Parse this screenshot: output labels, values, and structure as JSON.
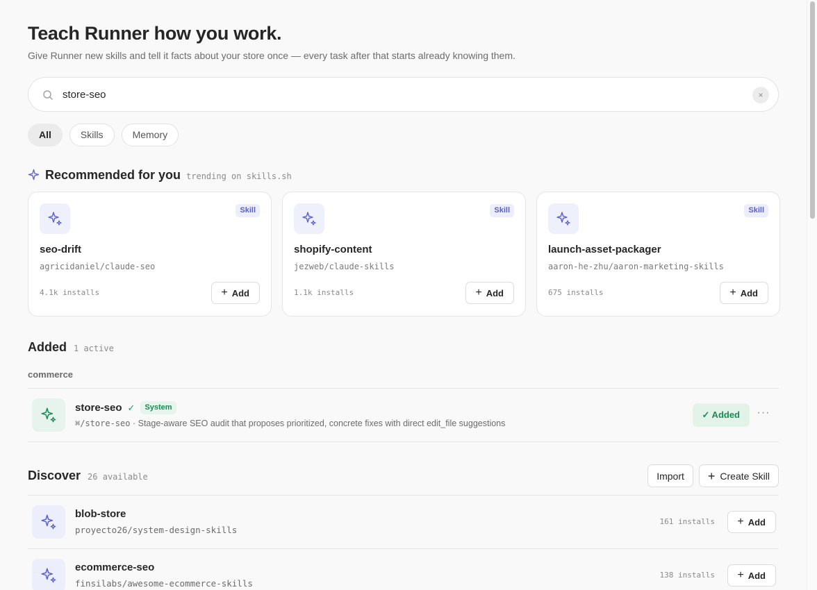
{
  "header": {
    "title": "Teach Runner how you work.",
    "subtitle": "Give Runner new skills and tell it facts about your store once — every task after that starts already knowing them."
  },
  "search": {
    "value": "store-seo",
    "clear_label": "×",
    "icon": "search-icon"
  },
  "filters": [
    "All",
    "Skills",
    "Memory"
  ],
  "filters_active": "All",
  "recommended": {
    "title": "Recommended for you",
    "subtitle": "trending on skills.sh",
    "icon": "sparkle-icon",
    "cards": [
      {
        "badge": "Skill",
        "name": "seo-drift",
        "repo": "agricidaniel/claude-seo",
        "installs": "4.1k installs",
        "add_label": "Add"
      },
      {
        "badge": "Skill",
        "name": "shopify-content",
        "repo": "jezweb/claude-skills",
        "installs": "1.1k installs",
        "add_label": "Add"
      },
      {
        "badge": "Skill",
        "name": "launch-asset-packager",
        "repo": "aaron-he-zhu/aaron-marketing-skills",
        "installs": "675 installs",
        "add_label": "Add"
      }
    ]
  },
  "added": {
    "title": "Added",
    "count": "1 active",
    "group": "commerce",
    "items": [
      {
        "name": "store-seo",
        "check": "✓",
        "badge": "System",
        "command": "⌘/store-seo",
        "separator": "·",
        "description": "Stage-aware SEO audit that proposes prioritized, concrete fixes with direct edit_file suggestions",
        "status_label": "✓  Added",
        "more": "···"
      }
    ]
  },
  "discover": {
    "title": "Discover",
    "count": "26 available",
    "import_label": "Import",
    "create_label": "Create Skill",
    "items": [
      {
        "name": "blob-store",
        "repo": "proyecto26/system-design-skills",
        "installs": "161 installs",
        "add_label": "Add"
      },
      {
        "name": "ecommerce-seo",
        "repo": "finsilabs/awesome-ecommerce-skills",
        "installs": "138 installs",
        "add_label": "Add"
      }
    ]
  },
  "colors": {
    "accent": "#5a5fc9",
    "success": "#1a8a55",
    "background": "#f9f9f9"
  }
}
